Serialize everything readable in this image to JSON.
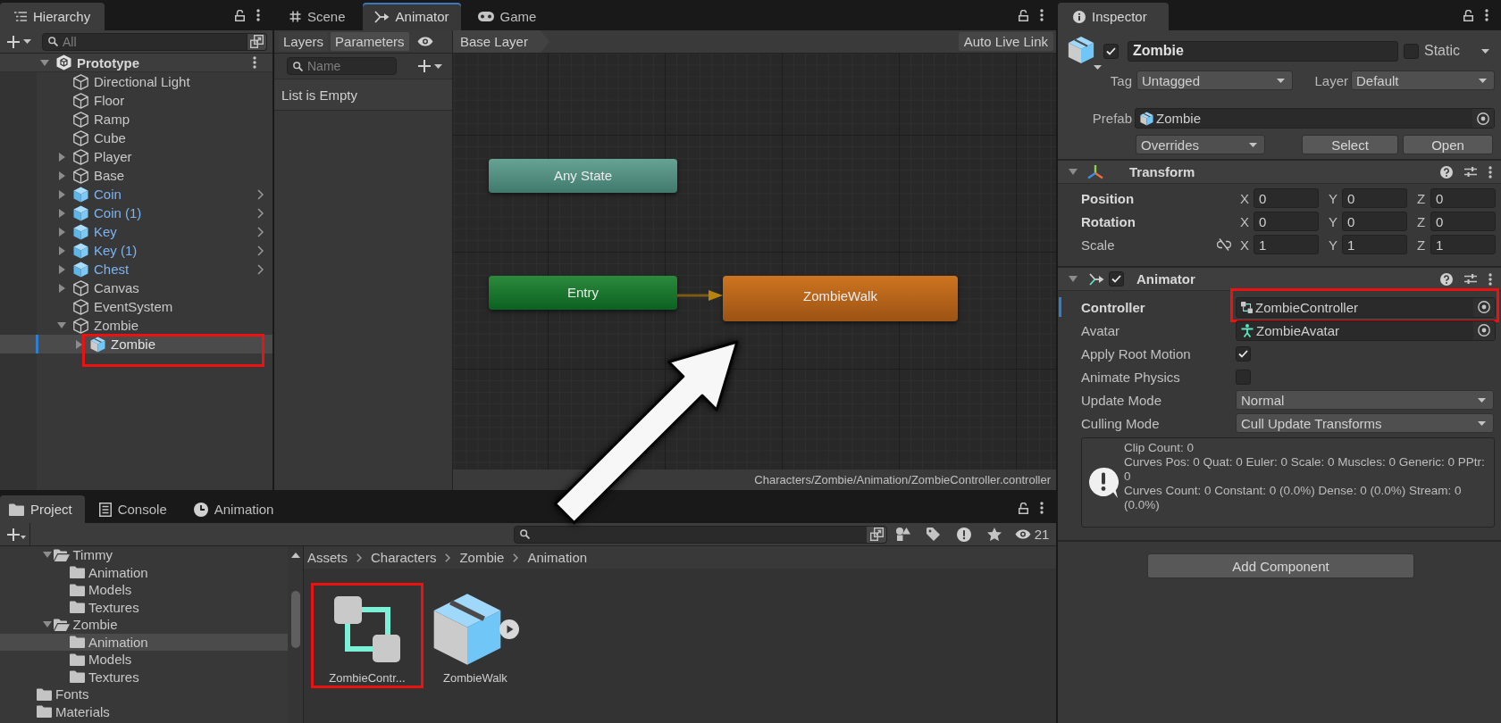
{
  "hierarchy": {
    "tabs": [
      {
        "label": "Hierarchy",
        "selected": true
      }
    ],
    "search": {
      "placeholder": "All"
    },
    "scene": {
      "name": "Prototype",
      "expanded": true
    },
    "items": [
      {
        "name": "Directional Light",
        "kind": "object",
        "selected": false,
        "highlighted": false
      },
      {
        "name": "Floor",
        "kind": "object",
        "selected": false,
        "highlighted": false
      },
      {
        "name": "Ramp",
        "kind": "object",
        "selected": false,
        "highlighted": false
      },
      {
        "name": "Cube",
        "kind": "object",
        "selected": false,
        "highlighted": false
      },
      {
        "name": "Player",
        "kind": "object",
        "expanded": false,
        "selected": false,
        "highlighted": false
      },
      {
        "name": "Base",
        "kind": "object",
        "expanded": false,
        "selected": false,
        "highlighted": false
      },
      {
        "name": "Coin",
        "kind": "prefab",
        "expanded": false,
        "selected": false,
        "highlighted": false
      },
      {
        "name": "Coin (1)",
        "kind": "prefab",
        "expanded": false,
        "selected": false,
        "highlighted": false
      },
      {
        "name": "Key",
        "kind": "prefab",
        "expanded": false,
        "selected": false,
        "highlighted": false
      },
      {
        "name": "Key (1)",
        "kind": "prefab",
        "expanded": false,
        "selected": false,
        "highlighted": false
      },
      {
        "name": "Chest",
        "kind": "prefab",
        "expanded": false,
        "selected": false,
        "highlighted": false
      },
      {
        "name": "Canvas",
        "kind": "object",
        "expanded": false,
        "selected": false,
        "highlighted": false
      },
      {
        "name": "EventSystem",
        "kind": "object",
        "selected": false,
        "highlighted": false
      },
      {
        "name": "Zombie",
        "kind": "object",
        "expanded": true,
        "selected": false,
        "highlighted": false,
        "children": [
          {
            "name": "Zombie",
            "kind": "model",
            "expanded": false,
            "selected": true,
            "highlighted": true
          }
        ]
      }
    ]
  },
  "center": {
    "tabs": [
      {
        "label": "Scene",
        "selected": false
      },
      {
        "label": "Animator",
        "selected": true
      },
      {
        "label": "Game",
        "selected": false
      }
    ]
  },
  "animator_window": {
    "modes": [
      {
        "label": "Layers",
        "selected": false
      },
      {
        "label": "Parameters",
        "selected": true
      }
    ],
    "breadcrumb": "Base Layer",
    "live_link": "Auto Live Link",
    "parameters": {
      "search": {
        "placeholder": "Name"
      },
      "empty_message": "List is Empty"
    },
    "graph": {
      "nodes": [
        {
          "label": "Any State",
          "kind": "any"
        },
        {
          "label": "Entry",
          "kind": "entry"
        },
        {
          "label": "ZombieWalk",
          "kind": "default"
        }
      ]
    },
    "path": "Characters/Zombie/Animation/ZombieController.controller"
  },
  "inspector": {
    "tabs": [
      {
        "label": "Inspector",
        "selected": true
      }
    ],
    "object": {
      "active": true,
      "name": "Zombie",
      "static": false,
      "static_label": "Static",
      "tag_label": "Tag",
      "tag": "Untagged",
      "layer_label": "Layer",
      "layer": "Default"
    },
    "prefab": {
      "label": "Prefab",
      "asset": "Zombie",
      "overrides": "Overrides",
      "buttons": [
        "Select",
        "Open"
      ]
    },
    "transform": {
      "title": "Transform",
      "expanded": true,
      "rows": [
        {
          "label": "Position",
          "overridden": true,
          "values": [
            {
              "axis": "X",
              "value": "0"
            },
            {
              "axis": "Y",
              "value": "0"
            },
            {
              "axis": "Z",
              "value": "0"
            }
          ]
        },
        {
          "label": "Rotation",
          "overridden": true,
          "values": [
            {
              "axis": "X",
              "value": "0"
            },
            {
              "axis": "Y",
              "value": "0"
            },
            {
              "axis": "Z",
              "value": "0"
            }
          ]
        },
        {
          "label": "Scale",
          "overridden": false,
          "constrained": false,
          "values": [
            {
              "axis": "X",
              "value": "1"
            },
            {
              "axis": "Y",
              "value": "1"
            },
            {
              "axis": "Z",
              "value": "1"
            }
          ]
        }
      ]
    },
    "animator": {
      "title": "Animator",
      "expanded": true,
      "enabled": true,
      "fields": [
        {
          "kind": "controller",
          "label": "Controller",
          "value": "ZombieController",
          "overridden": true,
          "highlighted": true
        },
        {
          "kind": "avatar",
          "label": "Avatar",
          "value": "ZombieAvatar",
          "overridden": false,
          "highlighted": false
        },
        {
          "kind": "checkbox",
          "label": "Apply Root Motion",
          "checked": true,
          "overridden": false,
          "highlighted": false
        },
        {
          "kind": "checkbox",
          "label": "Animate Physics",
          "checked": false,
          "overridden": false,
          "highlighted": false
        },
        {
          "kind": "dropdown",
          "label": "Update Mode",
          "value": "Normal",
          "overridden": false,
          "highlighted": false
        },
        {
          "kind": "dropdown",
          "label": "Culling Mode",
          "value": "Cull Update Transforms",
          "overridden": false,
          "highlighted": false
        }
      ],
      "info": [
        "Clip Count: 0",
        "Curves Pos: 0 Quat: 0 Euler: 0 Scale: 0 Muscles: 0 Generic: 0 PPtr: 0",
        "Curves Count: 0 Constant: 0 (0.0%) Dense: 0 (0.0%) Stream: 0 (0.0%)"
      ]
    },
    "add_component": "Add Component"
  },
  "project": {
    "tabs": [
      {
        "label": "Project",
        "selected": true
      },
      {
        "label": "Console",
        "selected": false
      },
      {
        "label": "Animation",
        "selected": false
      }
    ],
    "hidden_count": "21",
    "folders": [
      {
        "children": [
          {
            "name": "Timmy",
            "expanded": true,
            "selected": false,
            "children": [
              {
                "name": "Animation",
                "selected": false
              },
              {
                "name": "Models",
                "selected": false
              },
              {
                "name": "Textures",
                "selected": false
              }
            ]
          },
          {
            "name": "Zombie",
            "expanded": true,
            "selected": false,
            "children": [
              {
                "name": "Animation",
                "selected": true
              },
              {
                "name": "Models",
                "selected": false
              },
              {
                "name": "Textures",
                "selected": false
              }
            ]
          }
        ]
      },
      {
        "name": "Fonts",
        "selected": false
      },
      {
        "name": "Materials",
        "selected": false
      }
    ],
    "breadcrumb": [
      "Assets",
      "Characters",
      "Zombie",
      "Animation"
    ],
    "assets": [
      {
        "name": "ZombieContr...",
        "kind": "controller",
        "highlighted": true
      },
      {
        "name": "ZombieWalk",
        "kind": "model",
        "highlighted": false
      }
    ]
  }
}
